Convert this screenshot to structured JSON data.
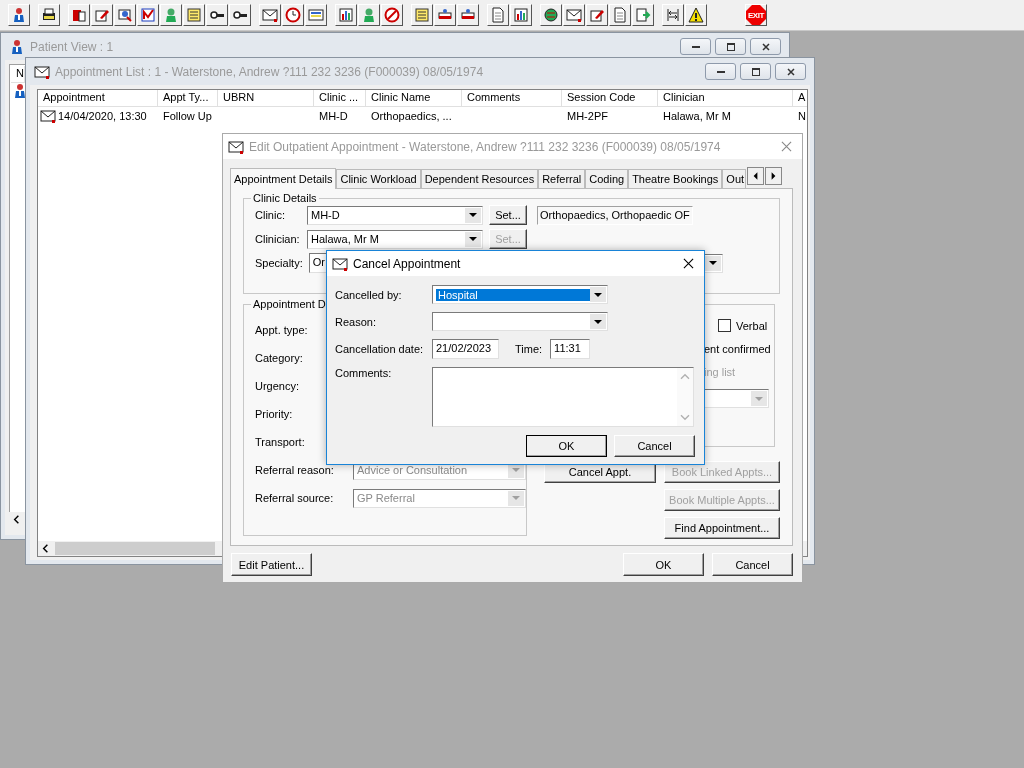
{
  "toolbar": {
    "exit_label": "EXIT"
  },
  "patient_view": {
    "title": "Patient View : 1",
    "list_header": "N"
  },
  "appointment_list": {
    "title": "Appointment List : 1 - Waterstone, Andrew ?111 232 3236 (F000039) 08/05/1974",
    "columns": [
      "Appointment",
      "Appt Ty...",
      "UBRN",
      "Clinic ...",
      "Clinic Name",
      "Comments",
      "Session Code",
      "Clinician",
      "A"
    ],
    "rows": [
      {
        "cells": [
          "14/04/2020, 13:30",
          "Follow Up",
          "",
          "MH-D",
          "Orthopaedics, ...",
          "",
          "MH-2PF",
          "Halawa, Mr M",
          "N"
        ]
      }
    ]
  },
  "edit_dialog": {
    "title": "Edit Outpatient Appointment - Waterstone, Andrew ?111 232 3236 (F000039) 08/05/1974",
    "tabs": [
      {
        "label": "Appointment Details",
        "selected": true
      },
      {
        "label": "Clinic Workload",
        "selected": false
      },
      {
        "label": "Dependent Resources",
        "selected": false
      },
      {
        "label": "Referral",
        "selected": false
      },
      {
        "label": "Coding",
        "selected": false
      },
      {
        "label": "Theatre Bookings",
        "selected": false
      },
      {
        "label": "Out",
        "selected": false
      }
    ],
    "clinic_details": {
      "legend": "Clinic Details",
      "clinic_label": "Clinic:",
      "clinic_value": "MH-D",
      "clinic_set": {
        "label": "Set...",
        "disabled": false
      },
      "clinic_name": "Orthopaedics, Orthopaedic OF",
      "clinician_label": "Clinician:",
      "clinician_value": "Halawa, Mr M",
      "clinician_set": {
        "label": "Set...",
        "disabled": true
      },
      "specialty_label": "Specialty:",
      "specialty_value": "Or"
    },
    "appointment_details": {
      "legend": "Appointment D",
      "fields": [
        {
          "label": "Appt. type:"
        },
        {
          "label": "Category:"
        },
        {
          "label": "Urgency:"
        },
        {
          "label": "Priority:"
        },
        {
          "label": "Transport:"
        },
        {
          "label": "Referral reason:",
          "value": "Advice or Consultation",
          "disabled": true
        },
        {
          "label": "Referral source:",
          "value": "GP Referral",
          "disabled": true
        }
      ]
    },
    "options": {
      "verbal": {
        "label": "Verbal",
        "checked": false
      },
      "confirmed_label": "ent confirmed",
      "waiting_label": "ing list",
      "waiting_disabled": true
    },
    "action_buttons": [
      {
        "label": "Cancel Appt.",
        "disabled": false
      },
      {
        "label": "Book Linked Appts...",
        "disabled": true
      },
      {
        "label": "Book Multiple Appts...",
        "disabled": true
      },
      {
        "label": "Find Appointment...",
        "disabled": false
      }
    ],
    "edit_patient": "Edit Patient...",
    "ok": "OK",
    "cancel": "Cancel"
  },
  "cancel_dialog": {
    "title": "Cancel Appointment",
    "cancelled_by_label": "Cancelled by:",
    "cancelled_by_value": "Hospital",
    "reason_label": "Reason:",
    "date_label": "Cancellation date:",
    "date_value": "21/02/2023",
    "time_label": "Time:",
    "time_value": "11:31",
    "comments_label": "Comments:",
    "ok": "OK",
    "cancel": "Cancel"
  }
}
